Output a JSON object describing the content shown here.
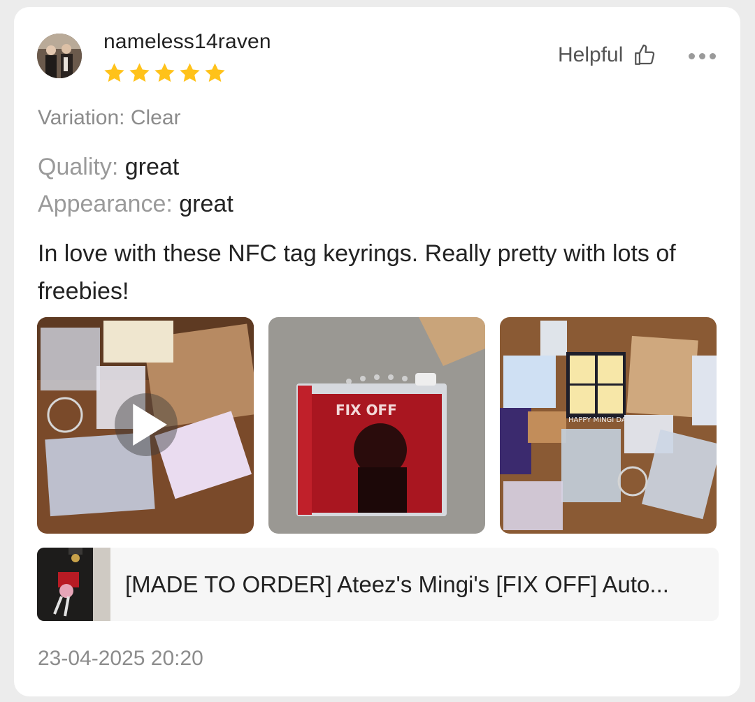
{
  "review": {
    "username": "nameless14raven",
    "rating": 5,
    "helpful_label": "Helpful",
    "variation": "Variation: Clear",
    "attributes": {
      "quality_label": "Quality:",
      "quality_value": "great",
      "appearance_label": "Appearance:",
      "appearance_value": "great"
    },
    "text": "In love with these NFC tag keyrings. Really pretty with lots of freebies!",
    "photos": [
      {
        "kind": "video",
        "icon": "play-icon"
      },
      {
        "kind": "image",
        "caption_text": "FIX OFF"
      },
      {
        "kind": "image",
        "caption_text": "HAPPY MINGI DAY"
      }
    ],
    "product": {
      "title": "[MADE TO ORDER] Ateez's Mingi's [FIX OFF] Auto..."
    },
    "date": "23-04-2025 20:20"
  },
  "colors": {
    "star": "#FFC21A",
    "text_primary": "#222222",
    "text_secondary": "#8C8C8C",
    "card_bg": "#FFFFFF",
    "page_bg": "#ECECEC"
  },
  "icons": {
    "helpful": "thumbs-up-icon",
    "more": "more-dots-icon",
    "star": "star-icon"
  }
}
